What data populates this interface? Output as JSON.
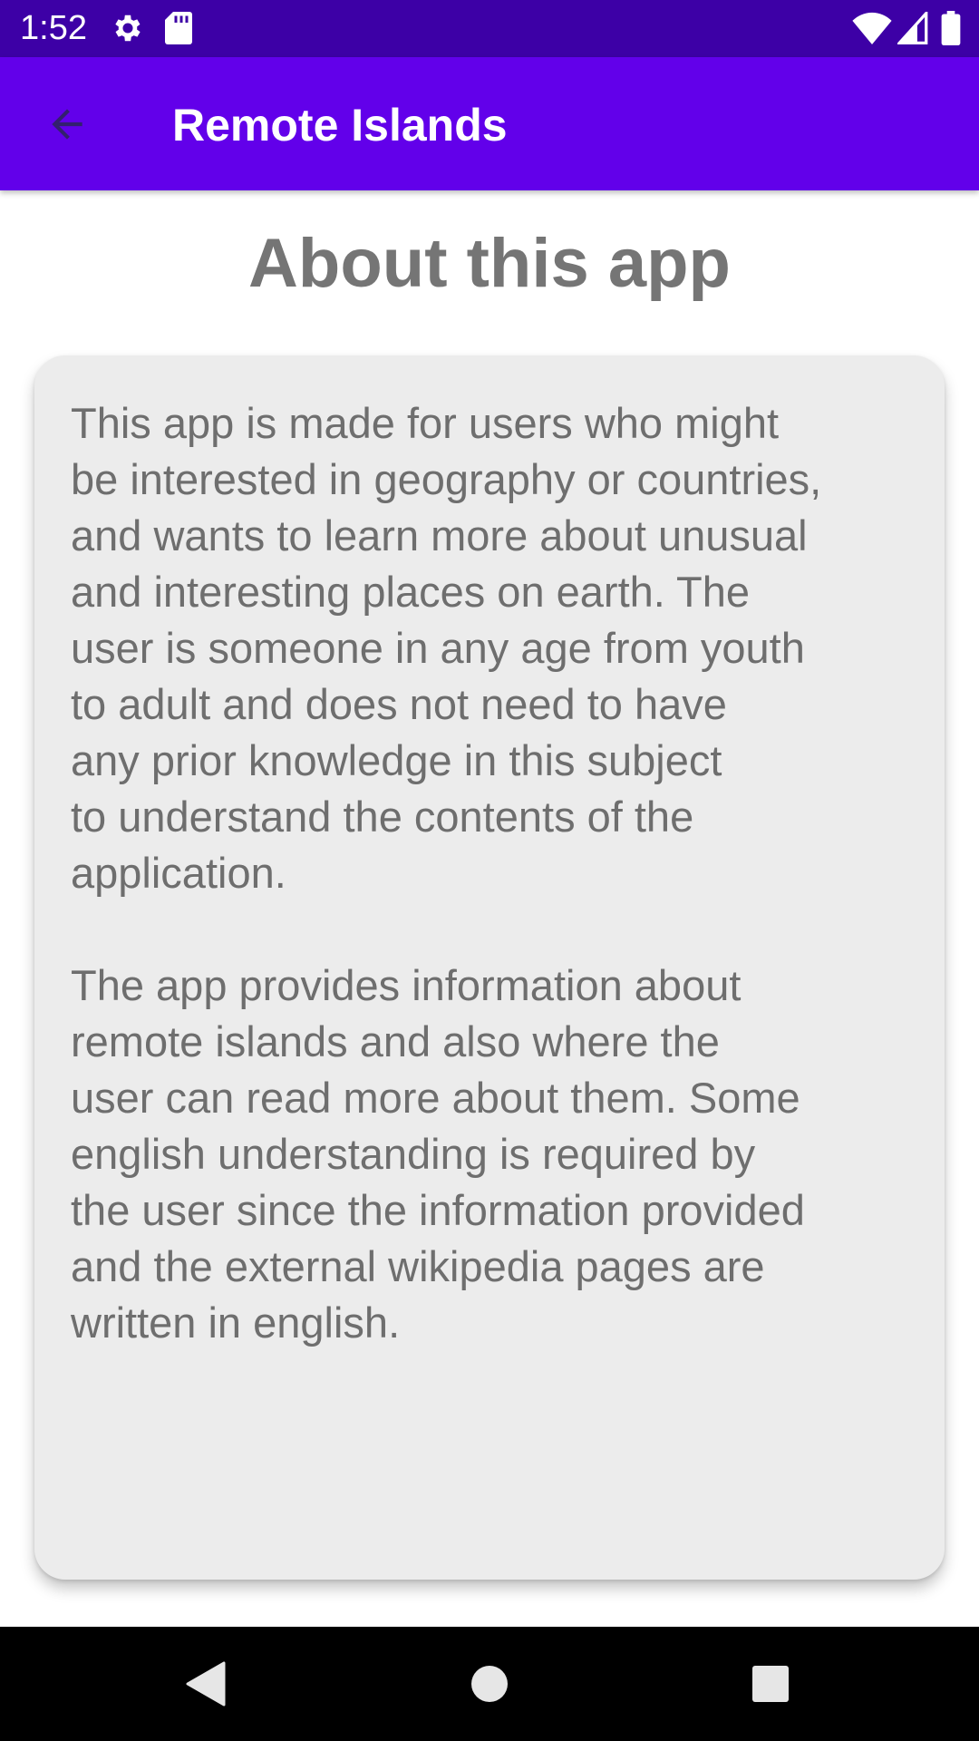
{
  "status_bar": {
    "time": "1:52",
    "background_color": "#3d00a6",
    "icons": [
      "gear-icon",
      "sd-card-icon",
      "wifi-icon",
      "cell-signal-icon",
      "battery-icon"
    ]
  },
  "app_bar": {
    "title": "Remote Islands",
    "background_color": "#6200ea",
    "back_icon": "arrow-left-icon"
  },
  "page": {
    "heading": "About this app",
    "paragraphs": [
      "This app is made for users who might\nbe interested in geography or countries,\nand wants to learn more about unusual\nand interesting places on earth. The\nuser is someone in any age from youth\nto adult and does not need to have\nany prior knowledge in this subject\nto understand the contents of the\napplication.",
      "The app provides information about\nremote islands and also where the\nuser can read more about them. Some\nenglish understanding is required by\nthe user since the information provided\nand the external wikipedia pages are\nwritten in english."
    ]
  },
  "nav_bar": {
    "icons": [
      "nav-back-icon",
      "nav-home-icon",
      "nav-recents-icon"
    ]
  }
}
